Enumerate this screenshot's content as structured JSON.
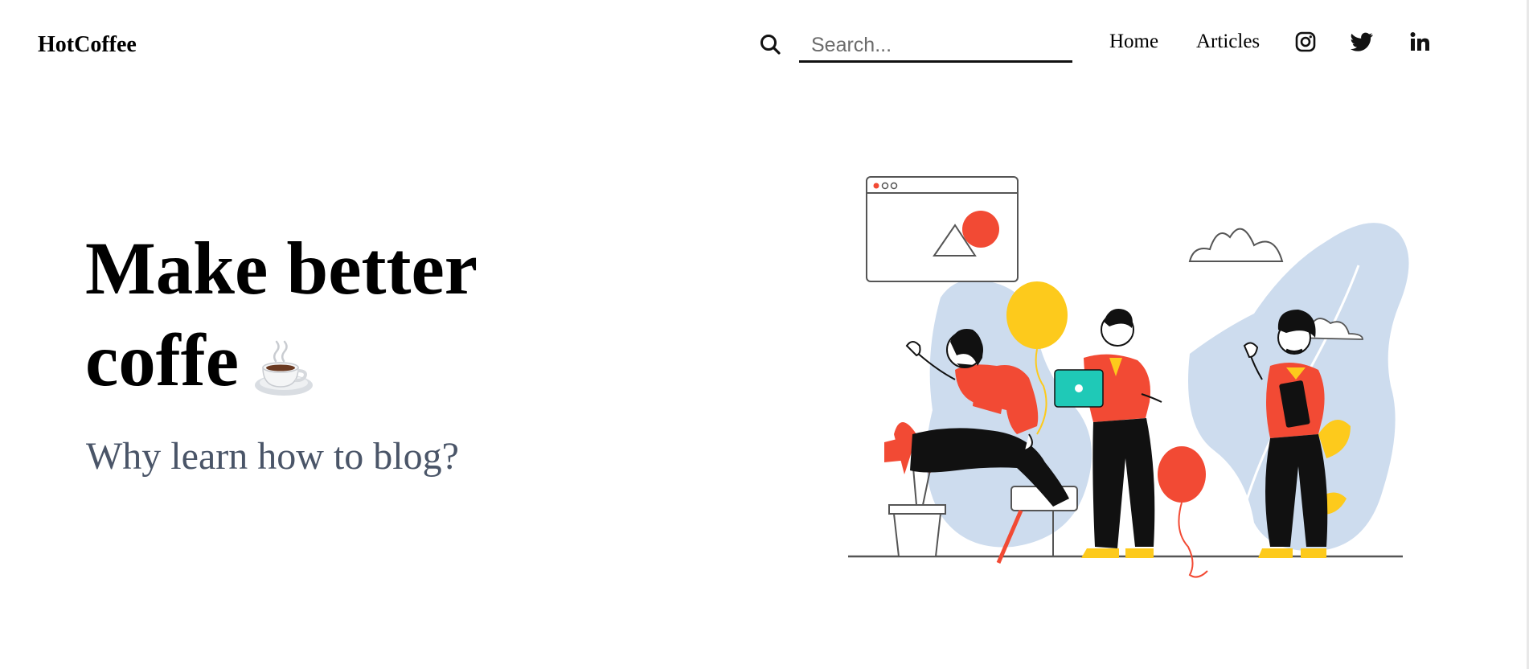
{
  "header": {
    "brand": "HotCoffee",
    "search": {
      "placeholder": "Search...",
      "value": ""
    },
    "nav": [
      {
        "label": "Home"
      },
      {
        "label": "Articles"
      }
    ],
    "social": [
      {
        "icon": "instagram-icon"
      },
      {
        "icon": "twitter-icon"
      },
      {
        "icon": "linkedin-icon"
      }
    ]
  },
  "hero": {
    "title_line1": "Make better",
    "title_line2": "coffe",
    "title_emoji": "hot-coffee-icon",
    "subtitle": "Why learn how to blog?",
    "illustration": "team-collaboration-illustration"
  },
  "colors": {
    "text": "#000000",
    "subtitle": "#4a5568",
    "accent_red": "#f24a34",
    "accent_yellow": "#fdca1c",
    "accent_blue": "#cdddef",
    "accent_teal": "#1fc9b7"
  }
}
